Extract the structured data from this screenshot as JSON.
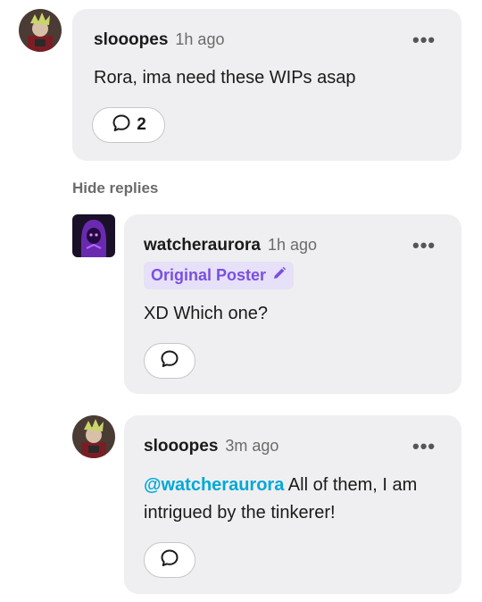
{
  "comments": [
    {
      "username": "slooopes",
      "time": "1h ago",
      "body": "Rora, ima need these WIPs asap",
      "reply_count": "2",
      "more": "•••"
    }
  ],
  "hide_replies": "Hide replies",
  "replies": [
    {
      "username": "watcheraurora",
      "time": "1h ago",
      "badge": "Original Poster",
      "body": "XD Which one?",
      "more": "•••"
    },
    {
      "username": "slooopes",
      "time": "3m ago",
      "mention": "@watcheraurora",
      "body": "All of them, I am intrigued by the tinkerer!",
      "more": "•••"
    }
  ],
  "colors": {
    "card_bg": "#efeff1",
    "mention": "#00a8d8",
    "badge_text": "#7a4fe0",
    "badge_bg": "#e6e0f8"
  },
  "icons": [
    "comment-bubble-icon",
    "pencil-icon",
    "more-options-icon"
  ]
}
